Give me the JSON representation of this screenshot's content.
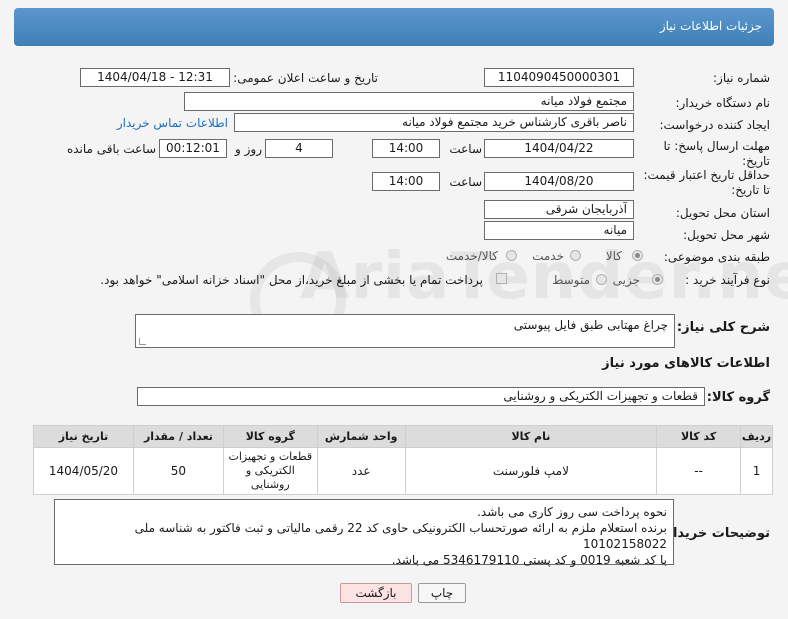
{
  "header": {
    "title": "جزئیات اطلاعات نیاز"
  },
  "fields": {
    "need_number": {
      "label": "شماره نیاز:",
      "value": "1104090450000301"
    },
    "announce_datetime": {
      "label": "تاریخ و ساعت اعلان عمومی:",
      "value": "1404/04/18 - 12:31"
    },
    "buyer_org": {
      "label": "نام دستگاه خریدار:",
      "value": "مجتمع فولاد میانه"
    },
    "requester": {
      "label": "ایجاد کننده درخواست:",
      "value": "ناصر باقری کارشناس خرید مجتمع فولاد میانه",
      "contact_link": "اطلاعات تماس خریدار"
    },
    "reply_deadline": {
      "label_line1": "مهلت ارسال پاسخ: تا",
      "label_line2": "تاریخ:",
      "date": "1404/04/22",
      "time_label": "ساعت",
      "time": "14:00",
      "days": "4",
      "days_label": "روز و",
      "remaining": "00:12:01",
      "remaining_label": "ساعت باقی مانده"
    },
    "price_validity": {
      "label_line1": "حداقل تاریخ اعتبار قیمت:",
      "label_line2": "تا تاریخ:",
      "date": "1404/08/20",
      "time_label": "ساعت",
      "time": "14:00"
    },
    "delivery_province": {
      "label": "استان محل تحویل:",
      "value": "آذربایجان شرقی"
    },
    "delivery_city": {
      "label": "شهر محل تحویل:",
      "value": "میانه"
    },
    "category": {
      "label": "طبقه بندی موضوعی:",
      "options": [
        "کالا",
        "خدمت",
        "کالا/خدمت"
      ],
      "selected": "کالا"
    },
    "purchase_process": {
      "label": "نوع فرآیند خرید :",
      "options": [
        "جزیی",
        "متوسط"
      ],
      "selected": "جزیی",
      "payment_note": "پرداخت تمام یا بخشی از مبلغ خرید،از محل \"اسناد خزانه اسلامی\" خواهد بود."
    },
    "need_description": {
      "label": "شرح کلی نیاز:",
      "value": "چراغ مهتابی طبق فایل پیوستی"
    }
  },
  "goods_section": {
    "title": "اطلاعات کالاهای مورد نیاز",
    "group_label": "گروه کالا:",
    "group_value": "قطعات و تجهیزات الکتریکی و روشنایی"
  },
  "table": {
    "headers": [
      "ردیف",
      "کد کالا",
      "نام کالا",
      "واحد شمارش",
      "گروه کالا",
      "تعداد / مقدار",
      "تاریخ نیاز"
    ],
    "rows": [
      {
        "row": "1",
        "code": "--",
        "name": "لامپ فلورسنت",
        "unit": "عدد",
        "group": "قطعات و تجهیزات الکتریکی و روشنایی",
        "quantity": "50",
        "need_date": "1404/05/20"
      }
    ]
  },
  "buyer_notes": {
    "label": "توضیحات خریدار:",
    "lines": [
      "نحوه پرداخت سی روز کاری می باشد.",
      "برنده استعلام ملزم به ارائه صورتحساب الکترونیکی حاوی کد 22 رقمی مالیاتی و ثبت فاکتور به شناسه ملی 10102158022",
      "با کد شعبه 0019 و کد پستی 5346179110 می باشد."
    ]
  },
  "buttons": {
    "print": "چاپ",
    "back": "بازگشت"
  },
  "watermark": {
    "text": "AriaTender.neT"
  },
  "colors": {
    "header": "#4f8ec4",
    "link": "#1e6fc2",
    "back_button": "#fbe3e3"
  }
}
